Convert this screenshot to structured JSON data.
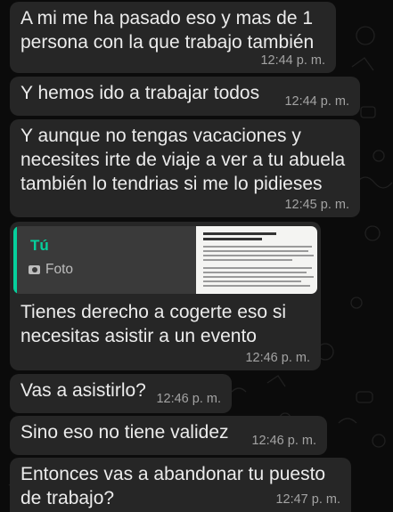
{
  "chat": {
    "messages": [
      {
        "text": "A mi me ha pasado eso y mas de 1 persona con la que trabajo también",
        "time": "12:44 p. m."
      },
      {
        "text": "Y hemos ido a trabajar todos",
        "time": "12:44 p. m."
      },
      {
        "text": "Y aunque no tengas vacaciones y necesites irte de viaje a ver a tu abuela también lo tendrias si me lo pidieses",
        "time": "12:45 p. m."
      },
      {
        "reply": {
          "author": "Tú",
          "kind": "Foto",
          "icon": "camera-icon",
          "accent": "#06cf9c"
        },
        "text": "Tienes derecho a cogerte eso si necesitas asistir a un evento",
        "time": "12:46 p. m."
      },
      {
        "text": "Vas a asistirlo?",
        "time": "12:46 p. m."
      },
      {
        "text": "Sino eso no tiene validez",
        "time": "12:46 p. m."
      },
      {
        "text": "Entonces vas a abandonar tu puesto de trabajo?",
        "time": "12:47 p. m."
      }
    ]
  },
  "colors": {
    "background": "#0b0b0b",
    "bubble": "#262626",
    "text": "#ececec",
    "timestamp": "#a3a3a3",
    "reply_accent": "#06cf9c"
  }
}
